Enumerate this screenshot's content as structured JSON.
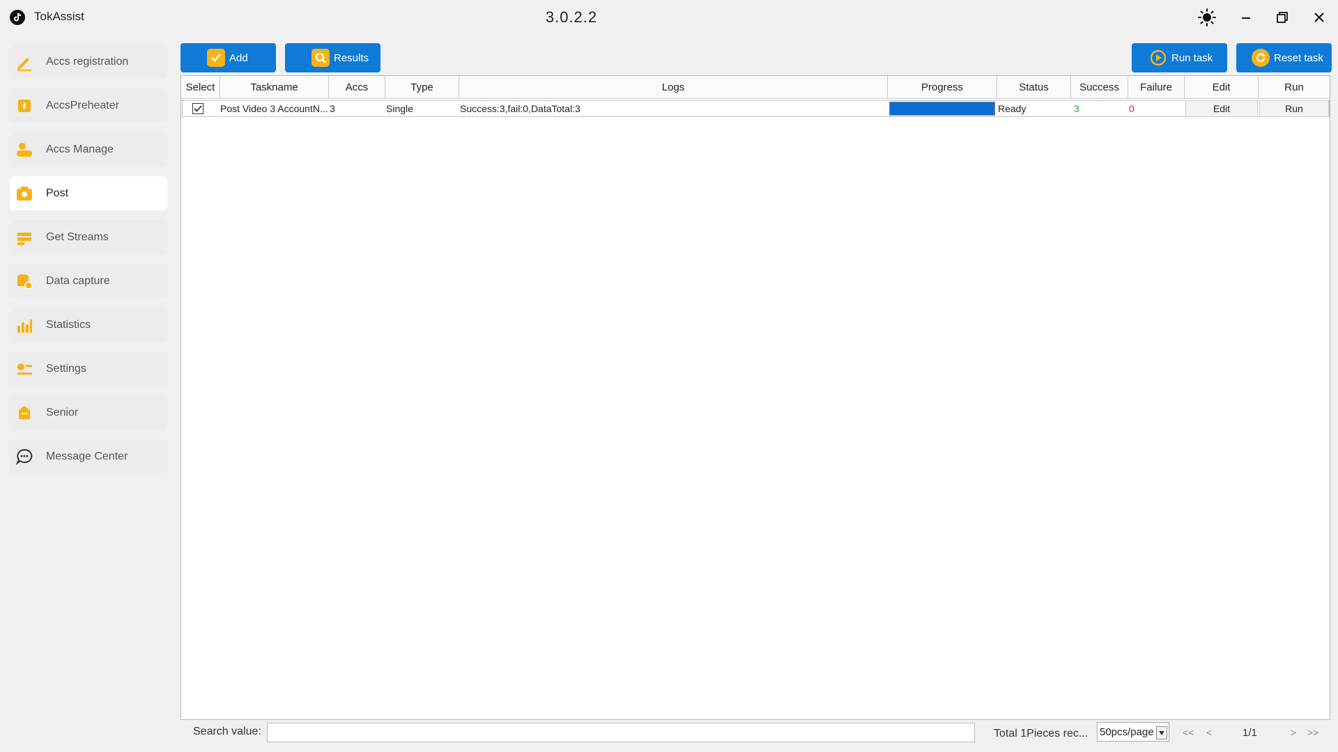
{
  "app": {
    "title": "TokAssist",
    "version": "3.0.2.2"
  },
  "window_controls": [
    "theme-toggle",
    "minimize",
    "restore",
    "close"
  ],
  "sidebar": {
    "items": [
      {
        "label": "Accs registration",
        "icon": "pencil-icon"
      },
      {
        "label": "AccsPreheater",
        "icon": "flame-icon"
      },
      {
        "label": "Accs Manage",
        "icon": "users-icon"
      },
      {
        "label": "Post",
        "icon": "camera-icon",
        "active": true
      },
      {
        "label": "Get Streams",
        "icon": "stream-icon"
      },
      {
        "label": "Data capture",
        "icon": "database-icon"
      },
      {
        "label": "Statistics",
        "icon": "bar-chart-icon"
      },
      {
        "label": "Settings",
        "icon": "settings-icon"
      },
      {
        "label": "Senior",
        "icon": "badge-icon"
      },
      {
        "label": "Message Center",
        "icon": "chat-icon"
      }
    ]
  },
  "toolbar": {
    "add": "Add",
    "results": "Results",
    "run_task": "Run task",
    "reset_task": "Reset task"
  },
  "table": {
    "headers": [
      "Select",
      "Taskname",
      "Accs",
      "Type",
      "Logs",
      "Progress",
      "Status",
      "Success",
      "Failure",
      "Edit",
      "Run"
    ],
    "rows": [
      {
        "selected": true,
        "taskname": "Post Video 3 AccountN...",
        "accs": "3",
        "type": "Single",
        "logs": "Success:3,fail:0,DataTotal:3",
        "progress": 1.0,
        "status": "Ready",
        "success": "3",
        "failure": "0",
        "edit": "Edit",
        "run": "Run"
      }
    ]
  },
  "footer": {
    "search_label": "Search value:",
    "search_value": "",
    "total": "Total 1Pieces rec...",
    "page_size": "50pcs/page",
    "page_indicator": "1/1",
    "first": "<<",
    "prev": "<",
    "next": ">",
    "last": ">>"
  },
  "colors": {
    "accent": "#0f7bd6",
    "icon_accent": "#f6b21a",
    "success": "#2e9e3a",
    "failure": "#e02020",
    "progress": "#0a6fd1"
  }
}
